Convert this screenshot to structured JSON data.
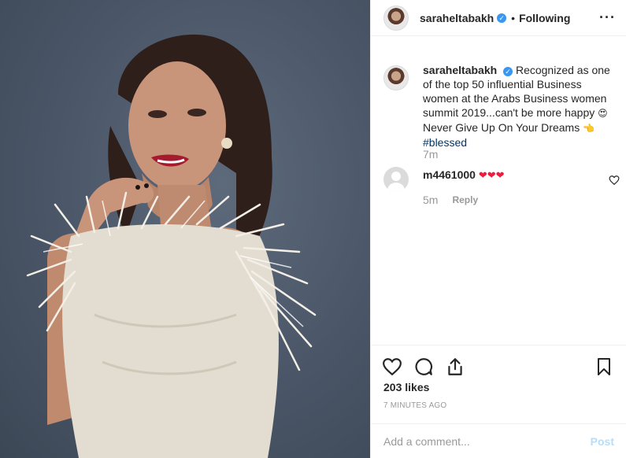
{
  "post": {
    "username": "saraheltabakh",
    "follow_status": "Following",
    "more_icon": "more-options-icon"
  },
  "caption": {
    "username": "saraheltabakh",
    "text": "Recognized as one of the top 50 influential Business women at the Arabs Business women summit 2019...can't be more happy",
    "text_after_emoji": "Never Give Up On Your Dreams",
    "hashtag": "#blessed",
    "time": "7m"
  },
  "comments": [
    {
      "username": "m4461000",
      "text": "❤❤❤",
      "time": "5m",
      "reply_label": "Reply"
    }
  ],
  "actions": {
    "like_icon": "heart-icon",
    "comment_icon": "comment-icon",
    "share_icon": "share-icon",
    "save_icon": "bookmark-icon"
  },
  "likes": "203 likes",
  "posted_ago": "7 MINUTES AGO",
  "add_comment": {
    "placeholder": "Add a comment...",
    "post_label": "Post"
  },
  "colors": {
    "verified": "#3897f0",
    "hashtag": "#003569",
    "post_disabled": "#b2dffc",
    "photo_background": "#4a5667"
  }
}
